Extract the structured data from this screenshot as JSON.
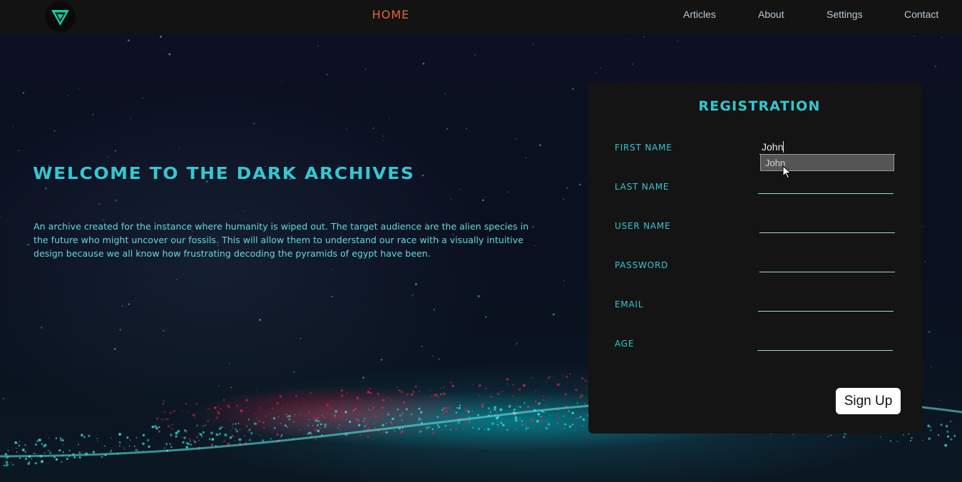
{
  "nav": {
    "home": "HOME",
    "links": [
      "Articles",
      "About",
      "Settings",
      "Contact"
    ]
  },
  "hero": {
    "title": "WELCOME TO THE DARK ARCHIVES",
    "text": "An archive created for the instance where humanity is wiped out. The target audience are the alien species in the future who might uncover our fossils. This will allow them to understand our race with a visually intuitive design because we all know how frustrating decoding the pyramids of egypt have been."
  },
  "registration": {
    "title": "REGISTRATION",
    "fields": [
      {
        "label": "FIRST NAME",
        "value": "John"
      },
      {
        "label": "LAST NAME",
        "value": ""
      },
      {
        "label": "USER NAME",
        "value": ""
      },
      {
        "label": "PASSWORD",
        "value": ""
      },
      {
        "label": "EMAIL",
        "value": ""
      },
      {
        "label": "AGE",
        "value": ""
      }
    ],
    "autocomplete": "John",
    "submit_label": "Sign Up"
  },
  "colors": {
    "accent": "#34c7d0",
    "home": "#e0653a",
    "navbar": "#131313",
    "card": "#141414"
  },
  "icons": {
    "logo": "triangle-v-logo-icon",
    "cursor": "mouse-pointer-icon"
  }
}
